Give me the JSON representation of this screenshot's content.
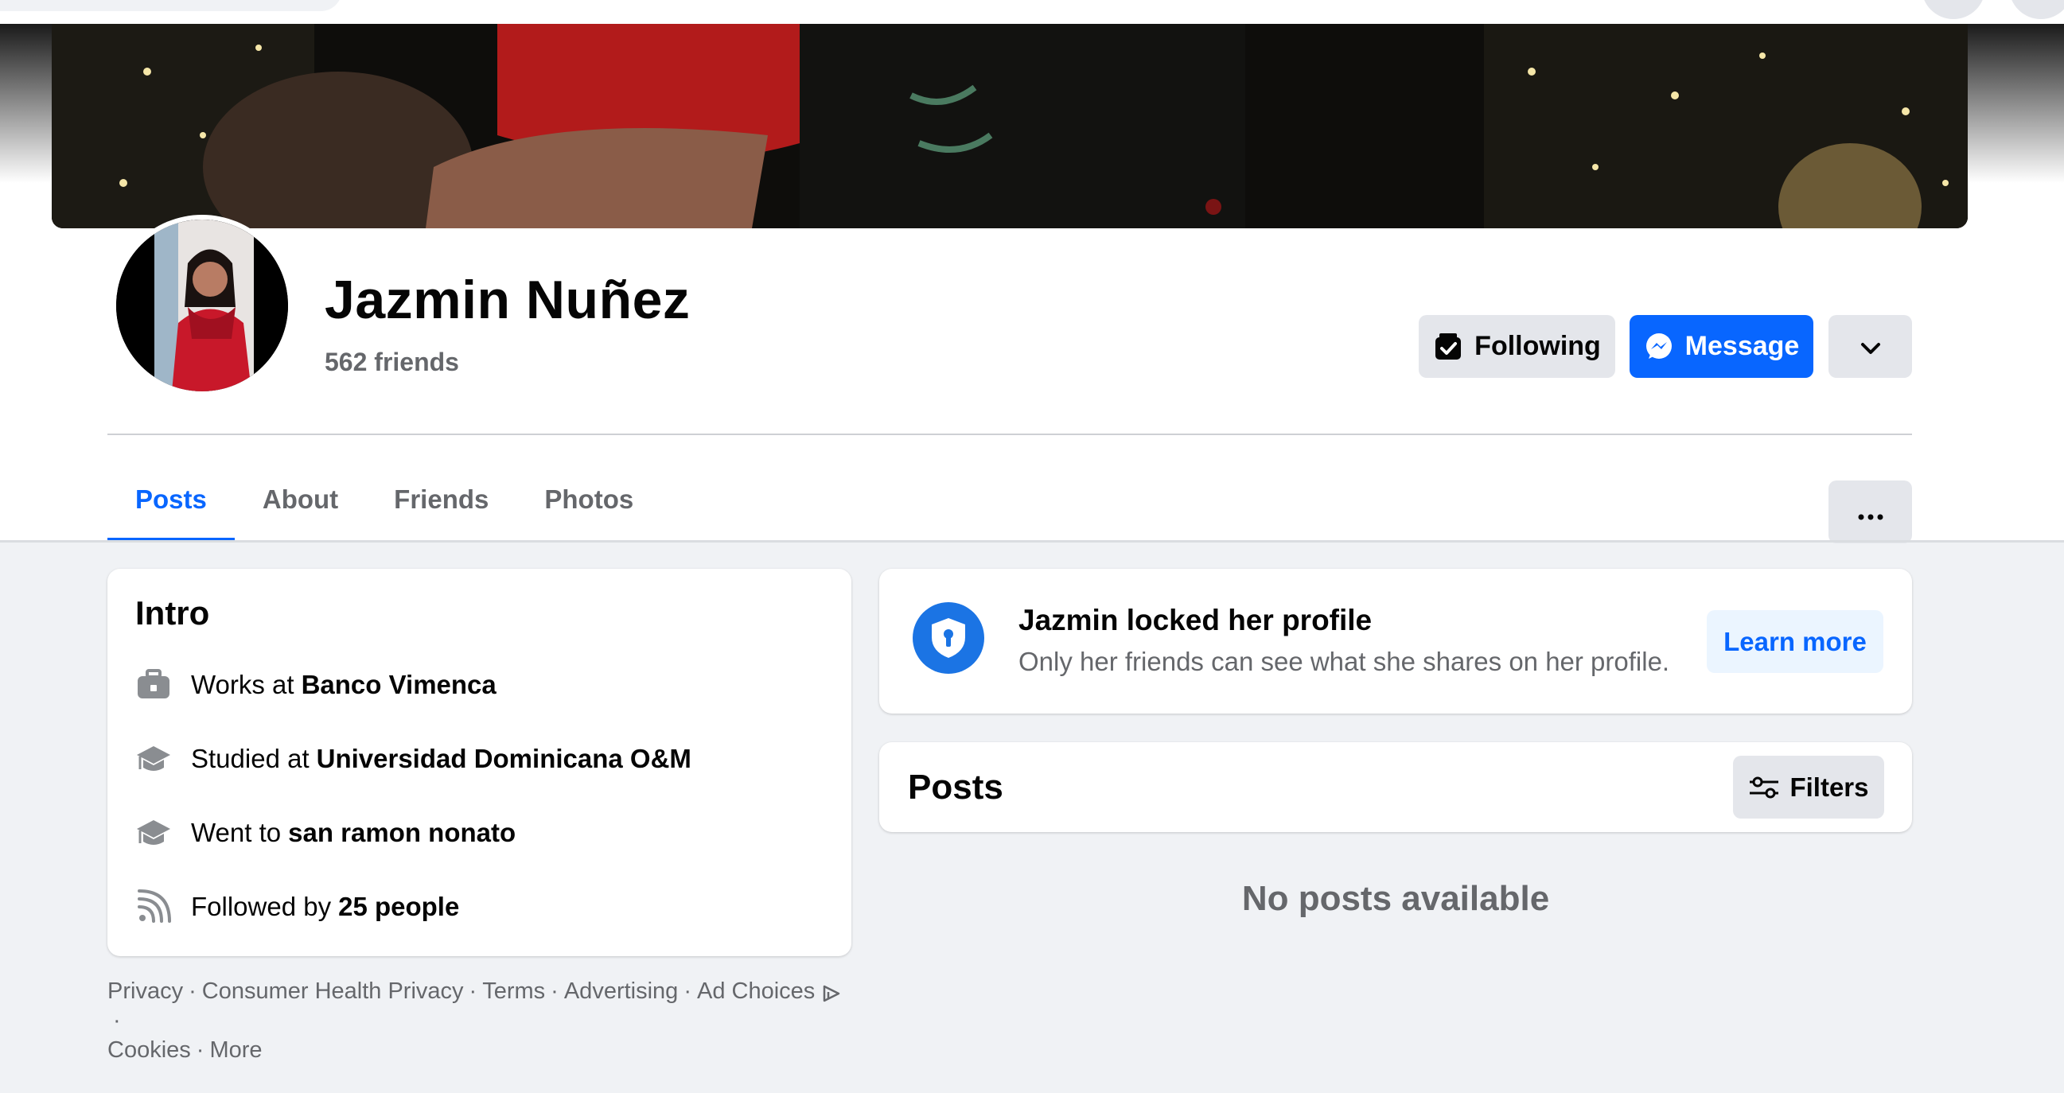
{
  "profile": {
    "name": "Jazmin Nuñez",
    "friends": "562 friends"
  },
  "actions": {
    "following": "Following",
    "message": "Message"
  },
  "tabs": [
    "Posts",
    "About",
    "Friends",
    "Photos"
  ],
  "active_tab": "Posts",
  "intro": {
    "title": "Intro",
    "items": [
      {
        "icon": "briefcase-icon",
        "prefix": "Works at",
        "value": "Banco Vimenca"
      },
      {
        "icon": "graduation-cap-icon",
        "prefix": "Studied at",
        "value": "Universidad Dominicana O&M"
      },
      {
        "icon": "graduation-cap-icon",
        "prefix": "Went to",
        "value": "san ramon nonato"
      },
      {
        "icon": "rss-icon",
        "prefix": "Followed by",
        "value": "25 people"
      }
    ]
  },
  "footer": {
    "links": [
      "Privacy",
      "Consumer Health Privacy",
      "Terms",
      "Advertising",
      "Ad Choices",
      "Cookies",
      "More"
    ],
    "separator": "·"
  },
  "locked": {
    "title": "Jazmin locked her profile",
    "subtitle": "Only her friends can see what she shares on her profile.",
    "learn_more": "Learn more"
  },
  "posts": {
    "title": "Posts",
    "filters": "Filters",
    "empty": "No posts available"
  },
  "colors": {
    "accent": "#0866ff",
    "secondary_text": "#65676b",
    "background": "#f0f2f5",
    "button_gray": "#e4e6eb"
  }
}
